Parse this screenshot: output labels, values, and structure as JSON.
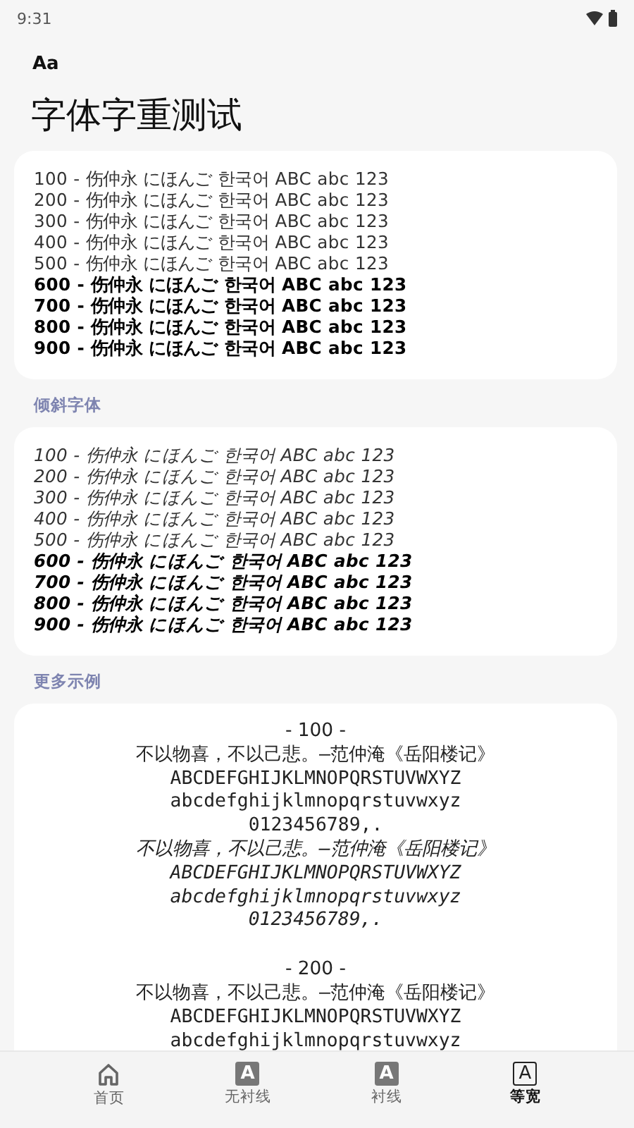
{
  "status_bar": {
    "time": "9:31"
  },
  "app_bar": {
    "logo": "Aa",
    "title": "字体字重测试"
  },
  "weights": [
    {
      "text": "100 - 伤仲永 にほんご 한국어 ABC abc 123",
      "bold": false
    },
    {
      "text": "200 - 伤仲永 にほんご 한국어 ABC abc 123",
      "bold": false
    },
    {
      "text": "300 - 伤仲永 にほんご 한국어 ABC abc 123",
      "bold": false
    },
    {
      "text": "400 - 伤仲永 にほんご 한국어 ABC abc 123",
      "bold": false
    },
    {
      "text": "500 - 伤仲永 にほんご 한국어 ABC abc 123",
      "bold": false
    },
    {
      "text": "600 - 伤仲永 にほんご 한국어 ABC abc 123",
      "bold": true
    },
    {
      "text": "700 - 伤仲永 にほんご 한국어 ABC abc 123",
      "bold": true
    },
    {
      "text": "800 - 伤仲永 にほんご 한국어 ABC abc 123",
      "bold": true
    },
    {
      "text": "900 - 伤仲永 にほんご 한국어 ABC abc 123",
      "bold": true
    }
  ],
  "italic_section": {
    "label": "倾斜字体",
    "lines": [
      {
        "text": "100 - 伤仲永 にほんご 한국어 ABC abc 123",
        "bold": false
      },
      {
        "text": "200 - 伤仲永 にほんご 한국어 ABC abc 123",
        "bold": false
      },
      {
        "text": "300 - 伤仲永 にほんご 한국어 ABC abc 123",
        "bold": false
      },
      {
        "text": "400 - 伤仲永 にほんご 한국어 ABC abc 123",
        "bold": false
      },
      {
        "text": "500 - 伤仲永 にほんご 한국어 ABC abc 123",
        "bold": false
      },
      {
        "text": "600 - 伤仲永 にほんご 한국어 ABC abc 123",
        "bold": true
      },
      {
        "text": "700 - 伤仲永 にほんご 한국어 ABC abc 123",
        "bold": true
      },
      {
        "text": "800 - 伤仲永 にほんご 한국어 ABC abc 123",
        "bold": true
      },
      {
        "text": "900 - 伤仲永 にほんご 한국어 ABC abc 123",
        "bold": true
      }
    ]
  },
  "more_section": {
    "label": "更多示例",
    "samples": [
      {
        "heading": "- 100 -",
        "upright": [
          "不以物喜，不以己悲。—范仲淹《岳阳楼记》",
          "ABCDEFGHIJKLMNOPQRSTUVWXYZ",
          "abcdefghijklmnopqrstuvwxyz",
          "0123456789,."
        ],
        "italic": [
          "不以物喜，不以己悲。—范仲淹《岳阳楼记》",
          "ABCDEFGHIJKLMNOPQRSTUVWXYZ",
          "abcdefghijklmnopqrstuvwxyz",
          "0123456789,."
        ]
      },
      {
        "heading": "- 200 -",
        "upright": [
          "不以物喜，不以己悲。—范仲淹《岳阳楼记》",
          "ABCDEFGHIJKLMNOPQRSTUVWXYZ",
          "abcdefghijklmnopqrstuvwxyz"
        ]
      }
    ]
  },
  "nav": [
    {
      "kind": "home",
      "label": "首页",
      "selected": false
    },
    {
      "kind": "letter",
      "glyph": "A",
      "label": "无衬线",
      "selected": false
    },
    {
      "kind": "letter",
      "glyph": "A",
      "label": "衬线",
      "selected": false
    },
    {
      "kind": "letter",
      "glyph": "A",
      "label": "等宽",
      "selected": true
    }
  ]
}
